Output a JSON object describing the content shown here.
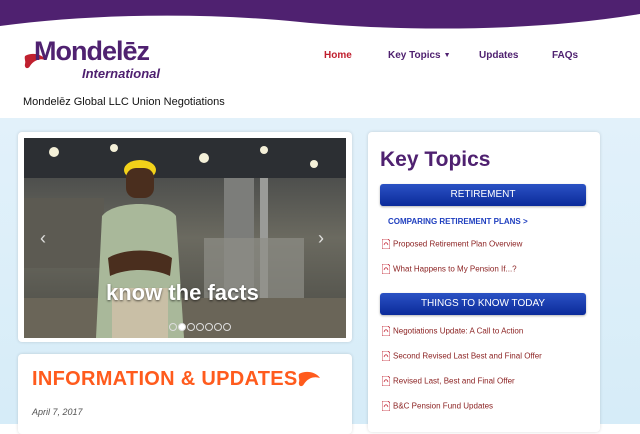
{
  "logo": {
    "wordmark": "Mondelēz",
    "sub": "International"
  },
  "nav": {
    "home": "Home",
    "key_topics": "Key Topics",
    "updates": "Updates",
    "faqs": "FAQs"
  },
  "site": {
    "subtitle": "Mondelēz Global LLC Union Negotiations"
  },
  "slider": {
    "caption": "know the facts",
    "prev": "‹",
    "next": "›",
    "dot_count": 7,
    "active_dot": 1
  },
  "info": {
    "title": "INFORMATION & UPDATES",
    "date": "April 7, 2017"
  },
  "key_topics": {
    "title": "Key Topics",
    "retirement": {
      "header": "RETIREMENT",
      "link": "COMPARING RETIREMENT PLANS >",
      "items": [
        "Proposed Retirement Plan Overview",
        "What Happens to My Pension If...?"
      ]
    },
    "things": {
      "header": "THINGS TO KNOW TODAY",
      "items": [
        "Negotiations Update: A Call to Action",
        "Second Revised Last Best and Final Offer",
        "Revised Last, Best and Final Offer",
        "B&C Pension Fund Updates"
      ]
    }
  },
  "colors": {
    "brand_purple": "#4f2170",
    "nav_active": "#c0202f",
    "accent_orange": "#ff5b1d",
    "section_blue": "#0b2a9a",
    "link_blue": "#1f3fbf",
    "pdf_red": "#8a1f1f"
  },
  "icons": [
    "logo-swoosh-icon",
    "caret-down-icon",
    "chevron-left-icon",
    "chevron-right-icon",
    "pdf-icon"
  ]
}
